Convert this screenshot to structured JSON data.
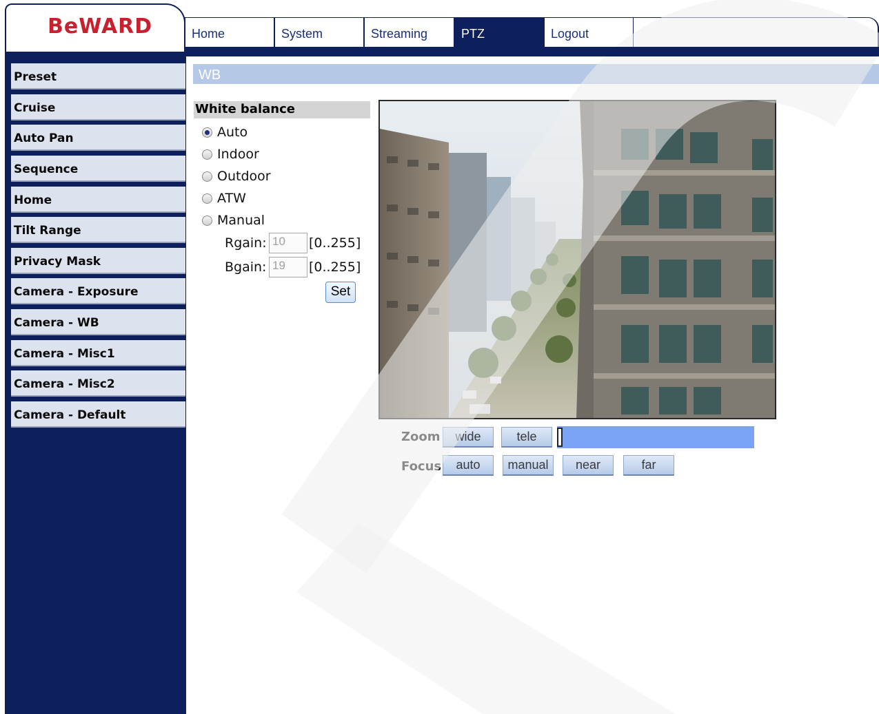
{
  "brand": {
    "logo_text": "BeWARD",
    "logo_color": "#c8202f",
    "navy": "#0d1f5c"
  },
  "nav": {
    "tabs": [
      {
        "label": "Home",
        "active": false
      },
      {
        "label": "System",
        "active": false
      },
      {
        "label": "Streaming",
        "active": false
      },
      {
        "label": "PTZ",
        "active": true
      },
      {
        "label": "Logout",
        "active": false
      }
    ]
  },
  "sidebar": {
    "items": [
      {
        "label": "Preset"
      },
      {
        "label": "Cruise"
      },
      {
        "label": "Auto Pan"
      },
      {
        "label": "Sequence"
      },
      {
        "label": "Home"
      },
      {
        "label": "Tilt Range"
      },
      {
        "label": "Privacy Mask"
      },
      {
        "label": "Camera - Exposure"
      },
      {
        "label": "Camera - WB"
      },
      {
        "label": "Camera - Misc1"
      },
      {
        "label": "Camera - Misc2"
      },
      {
        "label": "Camera - Default"
      }
    ]
  },
  "main": {
    "section_title": "WB",
    "white_balance": {
      "title": "White balance",
      "options": [
        {
          "label": "Auto",
          "checked": true
        },
        {
          "label": "Indoor",
          "checked": false
        },
        {
          "label": "Outdoor",
          "checked": false
        },
        {
          "label": "ATW",
          "checked": false
        },
        {
          "label": "Manual",
          "checked": false
        }
      ],
      "rgain": {
        "label": "Rgain:",
        "value": "10",
        "range": "[0..255]"
      },
      "bgain": {
        "label": "Bgain:",
        "value": "19",
        "range": "[0..255]"
      },
      "set_label": "Set"
    },
    "camera": {
      "icon": "camera-view-image"
    },
    "zoom": {
      "label": "Zoom",
      "wide_label": "wide",
      "tele_label": "tele",
      "level": 0
    },
    "focus": {
      "label": "Focus",
      "auto_label": "auto",
      "manual_label": "manual",
      "near_label": "near",
      "far_label": "far"
    }
  }
}
